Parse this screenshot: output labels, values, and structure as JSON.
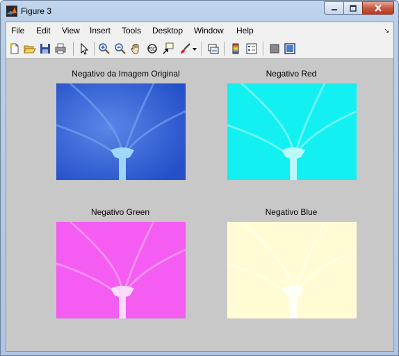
{
  "window": {
    "title": "Figure 3"
  },
  "menu": [
    "File",
    "Edit",
    "View",
    "Insert",
    "Tools",
    "Desktop",
    "Window",
    "Help"
  ],
  "toolbar_icons": [
    "new-figure-icon",
    "open-file-icon",
    "save-icon",
    "print-icon",
    "pointer-icon",
    "zoom-in-icon",
    "zoom-out-icon",
    "pan-hand-icon",
    "rotate-3d-icon",
    "data-cursor-icon",
    "brush-icon",
    "brush-dropdown-icon",
    "link-plot-icon",
    "colorbar-icon",
    "legend-icon",
    "hide-plot-tools-icon",
    "show-plot-tools-icon"
  ],
  "plots": [
    {
      "title": "Negativo da Imagem Original",
      "bg": "#2f62dc",
      "light": "#7ea5f2",
      "stem": "#a9e2ff"
    },
    {
      "title": "Negativo Red",
      "bg": "#12f0f2",
      "light": "#8ff8f8",
      "stem": "#c9fbfb"
    },
    {
      "title": "Negativo Green",
      "bg": "#f45cf2",
      "light": "#f6a8f4",
      "stem": "#fce0fb"
    },
    {
      "title": "Negativo Blue",
      "bg": "#fffbd4",
      "light": "#ffffe8",
      "stem": "#ffffff"
    }
  ]
}
